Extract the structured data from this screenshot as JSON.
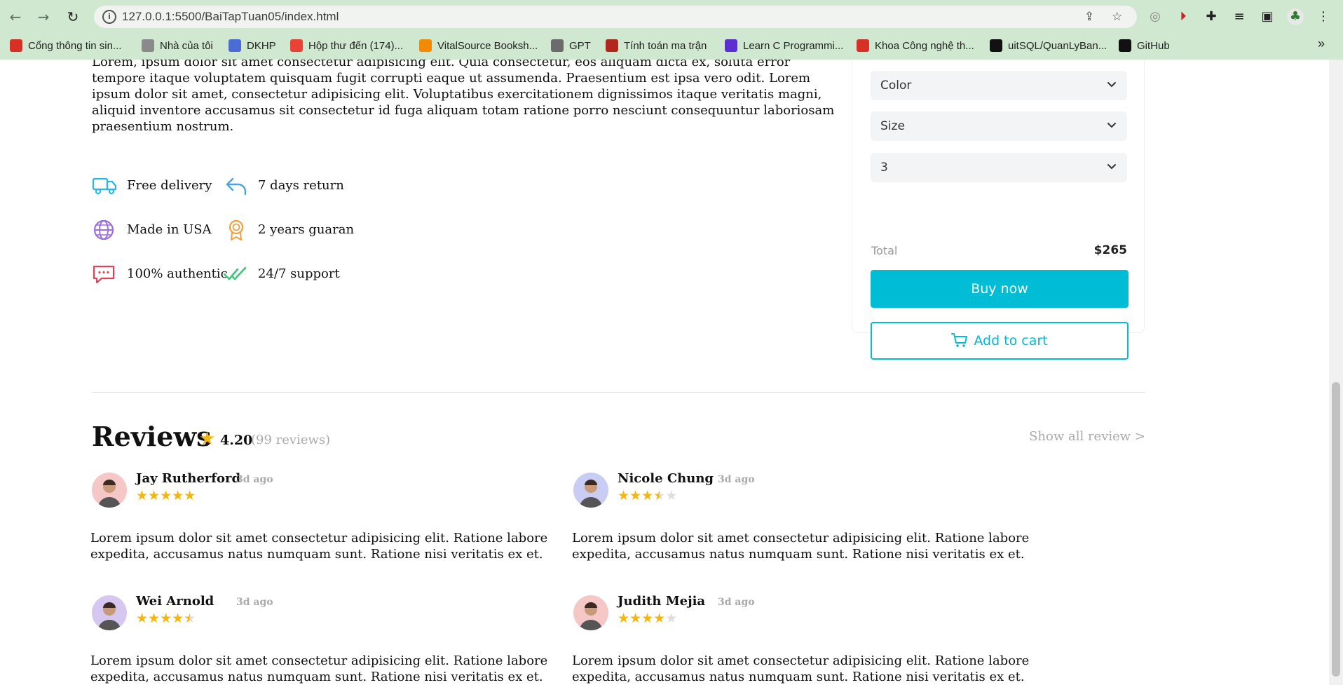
{
  "browser": {
    "url": "127.0.0.1:5500/BaiTapTuan05/index.html",
    "bookmarks": [
      {
        "label": "Cổng thông tin sin...",
        "color": "#d93025"
      },
      {
        "label": "Nhà của tôi",
        "color": "#8a8a8a"
      },
      {
        "label": "DKHP",
        "color": "#4a6cd4"
      },
      {
        "label": "Hộp thư đến (174)...",
        "color": "#ea4335"
      },
      {
        "label": "VitalSource Booksh...",
        "color": "#f28b00"
      },
      {
        "label": "GPT",
        "color": "#6b6b6b"
      },
      {
        "label": "Tính toán ma trận",
        "color": "#b3261e"
      },
      {
        "label": "Learn C Programmi...",
        "color": "#5b2fd1"
      },
      {
        "label": "Khoa Công nghệ th...",
        "color": "#d93025"
      },
      {
        "label": "uitSQL/QuanLyBan...",
        "color": "#111111"
      },
      {
        "label": "GitHub",
        "color": "#111111"
      }
    ]
  },
  "product": {
    "description": "Lorem, ipsum dolor sit amet consectetur adipisicing elit. Quia consectetur, eos aliquam dicta ex, soluta error tempore itaque voluptatem quisquam fugit corrupti eaque ut assumenda. Praesentium est ipsa vero odit. Lorem ipsum dolor sit amet, consectetur adipisicing elit. Voluptatibus exercitationem dignissimos itaque veritatis magni, aliquid inventore accusamus sit consectetur id fuga aliquam totam ratione porro nesciunt consequuntur laboriosam praesentium nostrum.",
    "policies": [
      {
        "label": "Free delivery",
        "icon": "truck-icon"
      },
      {
        "label": "7 days return",
        "icon": "return-arrow-icon"
      },
      {
        "label": "Made in USA",
        "icon": "globe-icon"
      },
      {
        "label": "2 years guaran",
        "icon": "award-icon"
      },
      {
        "label": "100% authentic",
        "icon": "chat-icon"
      },
      {
        "label": "24/7 support",
        "icon": "double-check-icon"
      }
    ]
  },
  "order_panel": {
    "color_select": "Color",
    "size_select": "Size",
    "quantity_select": "3",
    "total_label": "Total",
    "total_value": "$265",
    "buy_label": "Buy now",
    "cart_label": "Add to cart",
    "accent_color": "#00bcd4"
  },
  "reviews": {
    "title": "Reviews",
    "rating": "4.20",
    "count": "(99 reviews)",
    "show_all": "Show all review >",
    "items": [
      {
        "name": "Jay Rutherford",
        "date": "3d ago",
        "stars": 5,
        "avatar_bg": "#f6c7c7",
        "text": "Lorem ipsum dolor sit amet consectetur adipisicing elit. Ratione labore expedita, accusamus natus numquam sunt. Ratione nisi veritatis ex et."
      },
      {
        "name": "Nicole Chung",
        "date": "3d ago",
        "stars": 3.5,
        "avatar_bg": "#c9cdf3",
        "text": "Lorem ipsum dolor sit amet consectetur adipisicing elit. Ratione labore expedita, accusamus natus numquam sunt. Ratione nisi veritatis ex et."
      },
      {
        "name": "Wei Arnold",
        "date": "3d ago",
        "stars": 4.5,
        "avatar_bg": "#d6c7f1",
        "text": "Lorem ipsum dolor sit amet consectetur adipisicing elit. Ratione labore expedita, accusamus natus numquam sunt. Ratione nisi veritatis ex et."
      },
      {
        "name": "Judith Mejia",
        "date": "3d ago",
        "stars": 4,
        "avatar_bg": "#f6c7c7",
        "text": "Lorem ipsum dolor sit amet consectetur adipisicing elit. Ratione labore expedita, accusamus natus numquam sunt. Ratione nisi veritatis ex et."
      }
    ]
  }
}
